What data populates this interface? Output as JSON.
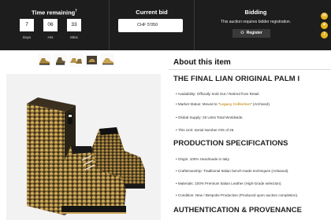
{
  "auction": {
    "time": {
      "title": "Time remaining",
      "footnote": "†",
      "units": [
        {
          "value": "7",
          "label": "Days"
        },
        {
          "value": "06",
          "label": "Hrs"
        },
        {
          "value": "33",
          "label": "Mins"
        }
      ]
    },
    "bid": {
      "title": "Current bid",
      "value": "CHF 5'050"
    },
    "bidding": {
      "title": "Bidding",
      "note": "This auction requires bidder registration.",
      "register_label": "Register"
    }
  },
  "side_actions": [
    {
      "icon": "email-icon"
    },
    {
      "icon": "twitter-icon"
    },
    {
      "icon": "facebook-icon"
    }
  ],
  "gallery": {
    "thumbnails": [
      {
        "icon": "sneaker-side-thumbnail"
      },
      {
        "icon": "sneaker-angle-thumbnail"
      },
      {
        "icon": "sneaker-pair-thumbnail"
      },
      {
        "icon": "sneaker-box-thumbnail"
      },
      {
        "icon": "sneaker-detail-thumbnail"
      }
    ]
  },
  "about": {
    "heading": "About this item",
    "title": "THE FINAL LIAN ORIGINAL PALM I",
    "details": [
      {
        "text": "Availability: Officially Sold Out / Retired from Retail."
      },
      {
        "prefix": "Market Status: Moved to \"",
        "highlight": "Legacy Collection",
        "suffix": "\" (Archived)."
      },
      {
        "text": "Global Supply: 25 Units Total Worldwide."
      },
      {
        "text": "This Unit: Serial Number #25 of 25."
      }
    ],
    "spec_heading": "PRODUCTION SPECIFICATIONS",
    "specs": [
      "Origin: 100% Handmade in Italy.",
      "Craftsmanship: Traditional Italian bench-made techniques (Artisanal).",
      "Materials: 100% Premium Italian Leather (High-Grade selection).",
      "Condition: New / Bespoke Production (Produced upon auction completion)."
    ],
    "auth_heading": "AUTHENTICATION & PROVENANCE"
  },
  "colors": {
    "accent": "#e8b51f",
    "gold_text": "#c9982c",
    "bar": "#1d1d1d"
  }
}
